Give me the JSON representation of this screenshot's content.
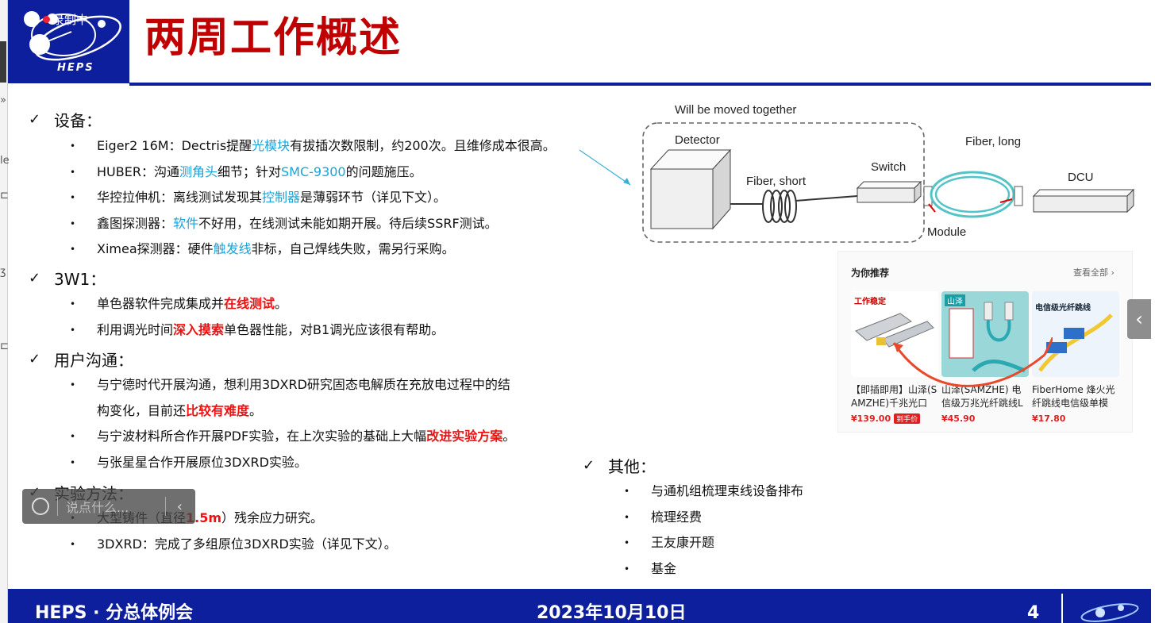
{
  "slide": {
    "title": "两周工作概述",
    "logo_text": "HEPS",
    "recording_label": "录制中"
  },
  "sections": [
    {
      "id": "equipment",
      "title": "设备："
    },
    {
      "id": "3w1",
      "title": "3W1："
    },
    {
      "id": "users",
      "title": "用户沟通："
    },
    {
      "id": "methods",
      "title": "实验方法："
    },
    {
      "id": "others",
      "title": "其他："
    }
  ],
  "equipment_items": [
    [
      {
        "t": "Eiger2 16M：Dectris提醒"
      },
      {
        "t": "光模块",
        "c": "blue"
      },
      {
        "t": "有拔插次数限制，约200次。且维修成本很高。"
      }
    ],
    [
      {
        "t": "HUBER：沟通"
      },
      {
        "t": "测角头",
        "c": "blue"
      },
      {
        "t": "细节；针对"
      },
      {
        "t": "SMC-9300",
        "c": "blue"
      },
      {
        "t": "的问题施压。"
      }
    ],
    [
      {
        "t": "华控拉伸机：离线测试发现其"
      },
      {
        "t": "控制器",
        "c": "blue"
      },
      {
        "t": "是薄弱环节（详见下文）。"
      }
    ],
    [
      {
        "t": "鑫图探测器："
      },
      {
        "t": "软件",
        "c": "blue"
      },
      {
        "t": "不好用，在线测试未能如期开展。待后续SSRF测试。"
      }
    ],
    [
      {
        "t": "Ximea探测器：硬件"
      },
      {
        "t": "触发线",
        "c": "blue"
      },
      {
        "t": "非标，自己焊线失败，需另行采购。"
      }
    ]
  ],
  "w1_items": [
    [
      {
        "t": "单色器软件完成集成并"
      },
      {
        "t": "在线测试",
        "c": "red"
      },
      {
        "t": "。"
      }
    ],
    [
      {
        "t": "利用调光时间"
      },
      {
        "t": "深入摸索",
        "c": "red"
      },
      {
        "t": "单色器性能，对B1调光应该很有帮助。"
      }
    ]
  ],
  "user_items": [
    [
      {
        "t": "与宁德时代开展沟通，想利用3DXRD研究固态电解质在充放电过程中的结"
      }
    ],
    [
      {
        "t": "构变化，目前还"
      },
      {
        "t": "比较有难度",
        "c": "red"
      },
      {
        "t": "。"
      }
    ],
    [
      {
        "t": "与宁波材料所合作开展PDF实验，在上次实验的基础上大幅"
      },
      {
        "t": "改进实验方案",
        "c": "red"
      },
      {
        "t": "。"
      }
    ],
    [
      {
        "t": "与张星星合作开展原位3DXRD实验。"
      }
    ]
  ],
  "method_items": [
    [
      {
        "t": "大型铸件（直径"
      },
      {
        "t": "1.5m",
        "c": "red"
      },
      {
        "t": "）残余应力研究。"
      }
    ],
    [
      {
        "t": "3DXRD：完成了多组原位3DXRD实验（详见下文）。"
      }
    ]
  ],
  "other_items": [
    [
      {
        "t": "与通机组梳理束线设备排布"
      }
    ],
    [
      {
        "t": "梳理经费"
      }
    ],
    [
      {
        "t": "王友康开题"
      }
    ],
    [
      {
        "t": "基金"
      }
    ]
  ],
  "diagram": {
    "group_label": "Will be moved together",
    "detector": "Detector",
    "fiber_short": "Fiber, short",
    "switch": "Switch",
    "fiber_long": "Fiber, long",
    "dcu": "DCU",
    "module": "Module"
  },
  "products": {
    "header": "为你推荐",
    "view_all": "查看全部 ›",
    "items": [
      {
        "name": "【即插即用】山泽(SAMZHE)千兆光口",
        "price": "¥139.00",
        "tag": "到手价",
        "img_label": "工作稳定"
      },
      {
        "name": "山泽(SAMZHE) 电信级万兆光纤跳线L",
        "price": "¥45.90",
        "tag": "",
        "img_label": "山泽"
      },
      {
        "name": "FiberHome 烽火光纤跳线电信级单模",
        "price": "¥17.80",
        "tag": "",
        "img_label": "电信级光纤跳线"
      }
    ]
  },
  "chat": {
    "placeholder": "说点什么..."
  },
  "footer": {
    "left": "HEPS ·  分总体例会",
    "date": "2023年10月10日",
    "page": "4"
  },
  "colors": {
    "brand_blue": "#0d1f9c",
    "title_red": "#c00000",
    "highlight_blue": "#1aa3d9",
    "highlight_red": "#e11111"
  }
}
